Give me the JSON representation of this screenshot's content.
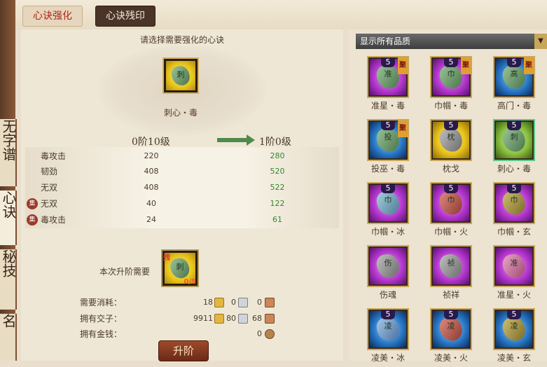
{
  "rail": [
    "无字谱",
    "心诀",
    "秘技",
    "名"
  ],
  "tabs": [
    {
      "label": "心诀强化"
    },
    {
      "label": "心诀残印"
    }
  ],
  "main": {
    "prompt": "请选择需要强化的心诀",
    "selected_name": "刺心・毒",
    "selected_glyph": "刺",
    "current_level": "0阶10级",
    "next_level": "1阶0级",
    "stats": [
      {
        "name": "毒攻击",
        "cur": "220",
        "next": "280",
        "ji": false
      },
      {
        "name": "韧劲",
        "cur": "408",
        "next": "520",
        "ji": false
      },
      {
        "name": "无双",
        "cur": "408",
        "next": "522",
        "ji": false
      },
      {
        "name": "无双",
        "cur": "40",
        "next": "122",
        "ji": true
      },
      {
        "name": "毒攻击",
        "cur": "24",
        "next": "61",
        "ji": true
      }
    ],
    "ji_label": "集",
    "requirement_label": "本次升阶需要",
    "requirement_item": {
      "badge": "残",
      "glyph": "刺",
      "count": "0/5"
    },
    "costs": [
      {
        "label": "需要消耗：",
        "gold": "18",
        "silver": "0",
        "copper": "0"
      },
      {
        "label": "拥有交子：",
        "gold": "9911",
        "silver": "80",
        "copper": "68"
      }
    ],
    "money_label": "拥有金钱：",
    "money_value": "0",
    "upgrade_button": "升阶"
  },
  "right": {
    "filter_label": "显示所有品质",
    "filter_arrow": "▼",
    "items": [
      {
        "name": "准星・毒",
        "num": "5",
        "zui": "聚",
        "quality": "purple",
        "stone": "green",
        "glyph": "准"
      },
      {
        "name": "巾帼・毒",
        "num": "5",
        "zui": "聚",
        "quality": "purple",
        "stone": "green",
        "glyph": "巾"
      },
      {
        "name": "高门・毒",
        "num": "5",
        "zui": "聚",
        "quality": "blue",
        "stone": "green",
        "glyph": "高"
      },
      {
        "name": "投巫・毒",
        "num": "5",
        "zui": "聚",
        "quality": "blue",
        "stone": "green",
        "glyph": "投"
      },
      {
        "name": "枕戈",
        "num": "5",
        "zui": "",
        "quality": "gold",
        "stone": "grey",
        "glyph": "枕"
      },
      {
        "name": "刺心・毒",
        "num": "5",
        "zui": "",
        "quality": "green",
        "stone": "green",
        "glyph": "刺"
      },
      {
        "name": "巾帼・冰",
        "num": "5",
        "zui": "",
        "quality": "purple",
        "stone": "cyan",
        "glyph": "巾"
      },
      {
        "name": "巾帼・火",
        "num": "5",
        "zui": "",
        "quality": "purple",
        "stone": "red",
        "glyph": "巾"
      },
      {
        "name": "巾帼・玄",
        "num": "5",
        "zui": "",
        "quality": "purple",
        "stone": "olive",
        "glyph": "巾"
      },
      {
        "name": "伤魂",
        "num": "",
        "zui": "",
        "quality": "purple",
        "stone": "grey",
        "glyph": "伤"
      },
      {
        "name": "祯祥",
        "num": "",
        "zui": "",
        "quality": "purple",
        "stone": "grey",
        "glyph": "祯"
      },
      {
        "name": "准星・火",
        "num": "",
        "zui": "",
        "quality": "purple",
        "stone": "pink",
        "glyph": "准"
      },
      {
        "name": "凌美・冰",
        "num": "5",
        "zui": "",
        "quality": "blue",
        "stone": "blue",
        "glyph": "凌"
      },
      {
        "name": "凌美・火",
        "num": "5",
        "zui": "",
        "quality": "blue",
        "stone": "red",
        "glyph": "凌"
      },
      {
        "name": "凌美・玄",
        "num": "5",
        "zui": "",
        "quality": "blue",
        "stone": "olive",
        "glyph": "凌"
      }
    ]
  }
}
